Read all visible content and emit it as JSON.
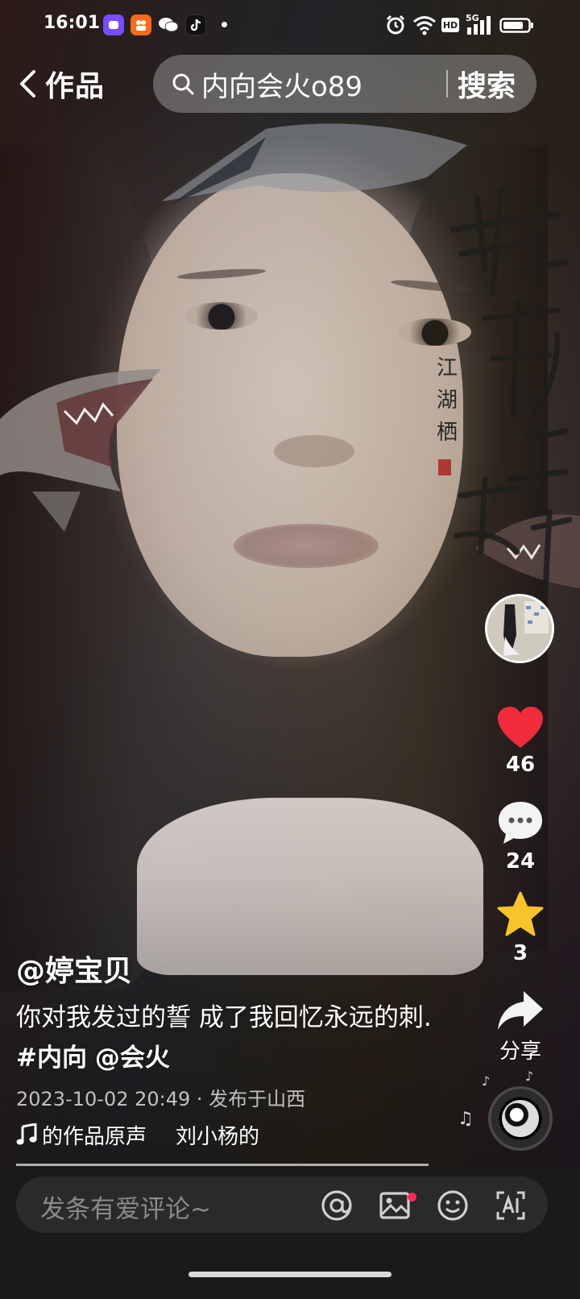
{
  "status_bar": {
    "time": "16:01",
    "app_icons": [
      "video-app-icon",
      "kuaishou-icon",
      "wechat-icon",
      "douyin-lite-icon"
    ],
    "network": "5G",
    "hd_badge": "HD"
  },
  "top_bar": {
    "back_label": "作品",
    "search_text": "内向会火o89",
    "search_button": "搜索"
  },
  "actions": {
    "likes": "46",
    "comments": "24",
    "favorites": "3",
    "share_label": "分享"
  },
  "post": {
    "author": "@婷宝贝",
    "description_text": "你对我发过的誓 成了我回忆永远的刺. ",
    "hashtag": "#内向",
    "mention": "@会火",
    "meta": "2023-10-02 20:49 · 发布于山西",
    "music_part1": "的作品原声",
    "music_part2": "刘小杨的"
  },
  "video_overlay": {
    "calligraphy_chars": [
      "往",
      "事",
      "已",
      "过",
      "半",
      "生"
    ],
    "seal_text": "江湖栖"
  },
  "comment_bar": {
    "placeholder": "发条有爱评论~"
  },
  "colors": {
    "like_red": "#fe2c55",
    "heart_red": "#f02b3c",
    "star_yellow": "#f7c52a",
    "comment_bar_bg": "#1a1a1a"
  }
}
